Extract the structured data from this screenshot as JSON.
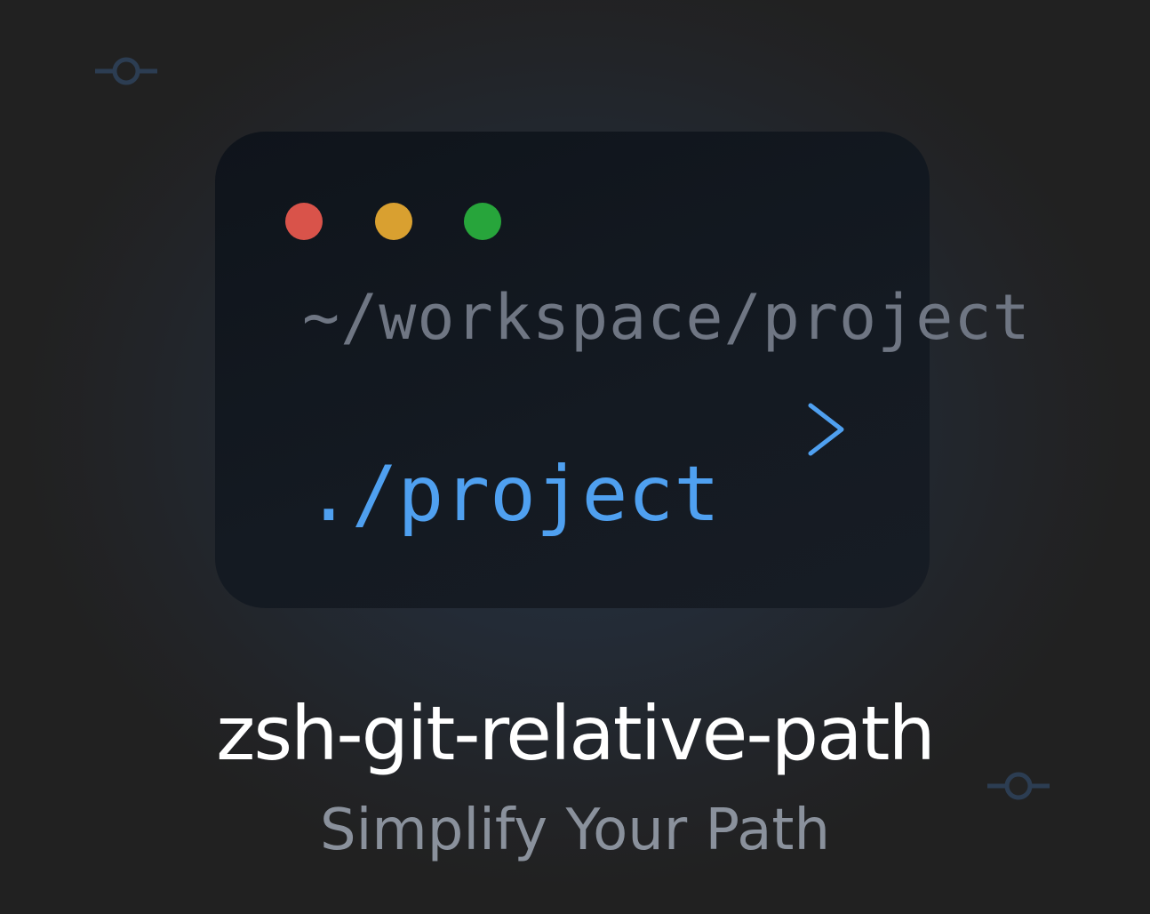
{
  "background": {
    "base_color": "#212121",
    "glow_color": "#253140"
  },
  "decorations": {
    "icons": [
      "git-commit-icon",
      "git-commit-icon"
    ],
    "color": "#2c3d52"
  },
  "terminal": {
    "window_controls": [
      {
        "name": "close",
        "color": "#d9534a"
      },
      {
        "name": "minimize",
        "color": "#d9a030"
      },
      {
        "name": "maximize",
        "color": "#27a53b"
      }
    ],
    "long_path": "~/workspace/project",
    "short_path": "./project",
    "arrow_icon": "arrow-right-icon",
    "colors": {
      "long_path": "#6f7683",
      "short_path": "#4fa0f0",
      "arrow": "#4fa0f0"
    }
  },
  "title": "zsh-git-relative-path",
  "subtitle": "Simplify Your Path"
}
